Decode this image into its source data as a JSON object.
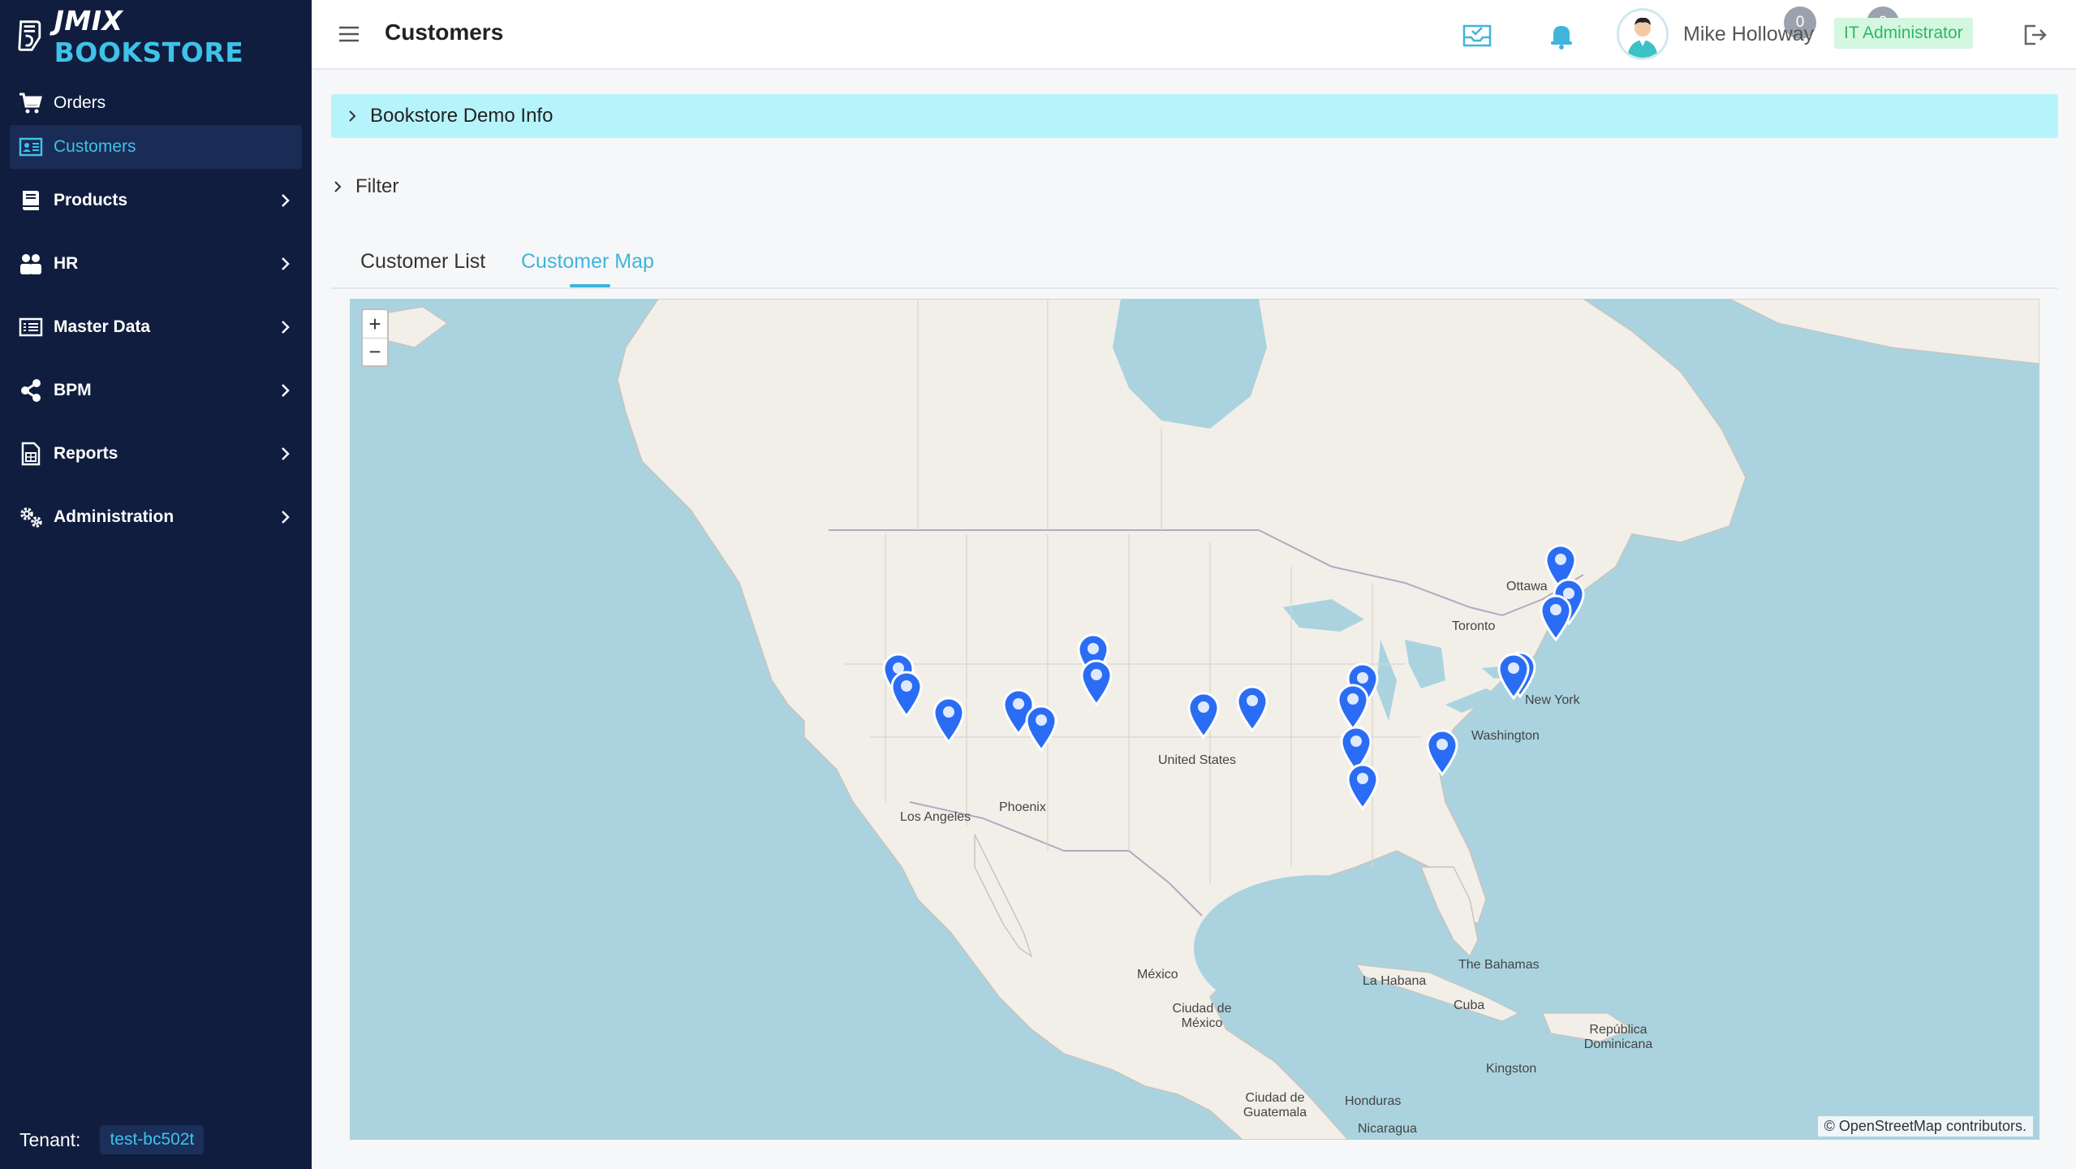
{
  "app": {
    "logo_a": "JMIX",
    "logo_b": "BOOKSTORE"
  },
  "sidebar": {
    "items": [
      {
        "label": "Orders"
      },
      {
        "label": "Customers"
      },
      {
        "label": "Products"
      },
      {
        "label": "HR"
      },
      {
        "label": "Master Data"
      },
      {
        "label": "BPM"
      },
      {
        "label": "Reports"
      },
      {
        "label": "Administration"
      }
    ],
    "tenant_label": "Tenant:",
    "tenant_value": "test-bc502t"
  },
  "header": {
    "title": "Customers",
    "tasks_count": "0",
    "notifications_count": "0",
    "user_name": "Mike Holloway",
    "role": "IT Administrator"
  },
  "main": {
    "demo_info": "Bookstore Demo Info",
    "filter": "Filter",
    "tabs": [
      {
        "label": "Customer List"
      },
      {
        "label": "Customer Map"
      }
    ]
  },
  "map": {
    "zoom_in": "+",
    "zoom_out": "−",
    "attribution_link": "© OpenStreetMap",
    "attribution_rest": " contributors.",
    "labels": {
      "ottawa": "Ottawa",
      "toronto": "Toronto",
      "new_york": "New York",
      "washington": "Washington",
      "united": "United States",
      "los_angeles": "Los Angeles",
      "phoenix": "Phoenix",
      "mexico": "México",
      "ciudad_mexico": "Ciudad de México",
      "la_habana": "La Habana",
      "bahamas": "The Bahamas",
      "cuba": "Cuba",
      "rep_dom": "República Dominicana",
      "kingston": "Kingston",
      "ciudad_guatemala": "Ciudad de Guatemala",
      "honduras": "Honduras",
      "nicaragua": "Nicaragua"
    },
    "marker_color": "#2a6df4"
  }
}
